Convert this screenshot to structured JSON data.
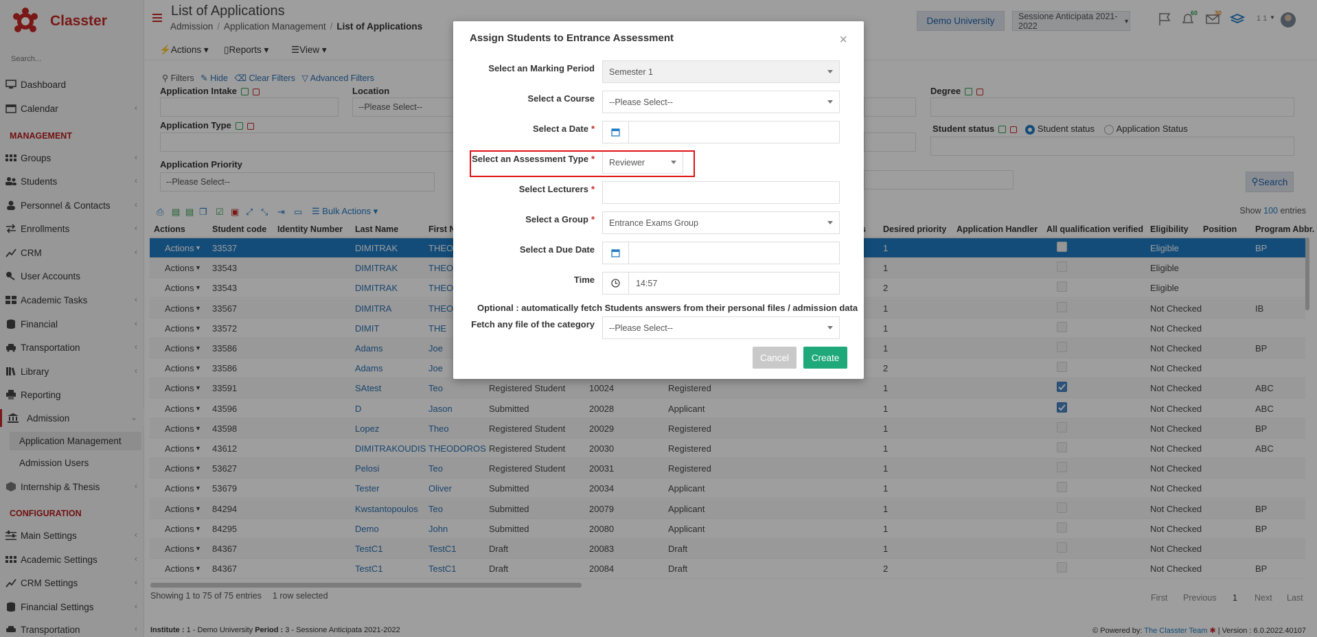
{
  "app": {
    "name": "Classter",
    "brand_color": "#c62828",
    "accent_color": "#1f7bc3"
  },
  "sidebar": {
    "search_placeholder": "Search...",
    "items": [
      {
        "label": "Dashboard",
        "icon": "monitor-icon"
      },
      {
        "label": "Calendar",
        "icon": "calendar-icon"
      },
      {
        "label": "Groups",
        "icon": "groups-icon"
      },
      {
        "label": "Students",
        "icon": "users-icon"
      },
      {
        "label": "Personnel & Contacts",
        "icon": "person-icon"
      },
      {
        "label": "Enrollments",
        "icon": "exchange-icon"
      },
      {
        "label": "CRM",
        "icon": "chart-icon"
      },
      {
        "label": "User Accounts",
        "icon": "key-icon"
      },
      {
        "label": "Academic Tasks",
        "icon": "grid-icon"
      },
      {
        "label": "Financial",
        "icon": "database-icon"
      },
      {
        "label": "Transportation",
        "icon": "car-icon"
      },
      {
        "label": "Library",
        "icon": "books-icon"
      },
      {
        "label": "Reporting",
        "icon": "print-icon"
      },
      {
        "label": "Admission",
        "icon": "bank-icon"
      },
      {
        "label": "Internship & Thesis",
        "icon": "cube-icon"
      },
      {
        "label": "Main Settings",
        "icon": "sliders-icon"
      },
      {
        "label": "Academic Settings",
        "icon": "groups-icon"
      },
      {
        "label": "CRM Settings",
        "icon": "chart-icon"
      },
      {
        "label": "Financial Settings",
        "icon": "database-icon"
      },
      {
        "label": "Transportation",
        "icon": "car-icon"
      }
    ],
    "heading_management": "MANAGEMENT",
    "heading_configuration": "CONFIGURATION",
    "sub_items": [
      "Application Management",
      "Admission Users"
    ]
  },
  "header": {
    "title": "List of Applications",
    "breadcrumb": [
      "Admission",
      "Application Management",
      "List of Applications"
    ],
    "institution": "Demo University",
    "period": "Sessione Anticipata 2021-2022",
    "badge_notifications": "60",
    "badge_messages": "30",
    "user_count": "1 1"
  },
  "toolbar": {
    "actions": "Actions",
    "reports": "Reports",
    "view": "View"
  },
  "filters": {
    "title": "Filters",
    "hide": "Hide",
    "clear": "Clear Filters",
    "advanced": "Advanced Filters",
    "application_intake": "Application Intake",
    "location": "Location",
    "location_value": "--Please Select--",
    "degree": "Degree",
    "application_type": "Application Type",
    "student_status": "Student status",
    "radio_student_status": "Student status",
    "radio_application_status": "Application Status",
    "application_priority": "Application Priority",
    "priority_value": "--Please Select--",
    "search": "Search"
  },
  "grid": {
    "bulk_actions": "Bulk Actions",
    "show_label": "Show",
    "show_value": "100",
    "entries_label": "entries",
    "columns": [
      "Actions",
      "Student code",
      "Identity Number",
      "Last Name",
      "First N",
      "s",
      "Desired priority",
      "Application Handler",
      "All qualification verified",
      "Eligibility",
      "Position",
      "Program Abbr."
    ],
    "rows": [
      {
        "action": "Actions",
        "code": "33537",
        "last": "DIMITRAK",
        "first": "THEO",
        "status": "",
        "num": "",
        "reg": "",
        "priority": "1",
        "verified": false,
        "eligibility": "Eligible",
        "program": "BP"
      },
      {
        "action": "Actions",
        "code": "33543",
        "last": "DIMITRAK",
        "first": "THEO",
        "status": "",
        "num": "",
        "reg": "",
        "priority": "1",
        "verified": false,
        "eligibility": "Eligible",
        "program": ""
      },
      {
        "action": "Actions",
        "code": "33543",
        "last": "DIMITRAK",
        "first": "THEO",
        "status": "",
        "num": "",
        "reg": "",
        "priority": "2",
        "verified": false,
        "eligibility": "Eligible",
        "program": ""
      },
      {
        "action": "Actions",
        "code": "33567",
        "last": "DIMITRA",
        "first": "THEO",
        "status": "",
        "num": "",
        "reg": "",
        "priority": "1",
        "verified": false,
        "eligibility": "Not Checked",
        "program": "IB"
      },
      {
        "action": "Actions",
        "code": "33572",
        "last": "DIMIT",
        "first": "THE",
        "status": "",
        "num": "",
        "reg": "",
        "priority": "1",
        "verified": false,
        "eligibility": "Not Checked",
        "program": ""
      },
      {
        "action": "Actions",
        "code": "33586",
        "last": "Adams",
        "first": "Joe",
        "status": "",
        "num": "",
        "reg": "",
        "priority": "1",
        "verified": false,
        "eligibility": "Not Checked",
        "program": "BP"
      },
      {
        "action": "Actions",
        "code": "33586",
        "last": "Adams",
        "first": "Joe",
        "status": "",
        "num": "",
        "reg": "",
        "priority": "2",
        "verified": false,
        "eligibility": "Not Checked",
        "program": ""
      },
      {
        "action": "Actions",
        "code": "33591",
        "last": "SAtest",
        "first": "Teo",
        "status": "Registered Student",
        "num": "10024",
        "reg": "Registered",
        "priority": "1",
        "verified": true,
        "eligibility": "Not Checked",
        "program": "ABC"
      },
      {
        "action": "Actions",
        "code": "43596",
        "last": "D",
        "first": "Jason",
        "status": "Submitted",
        "num": "20028",
        "reg": "Applicant",
        "priority": "1",
        "verified": true,
        "eligibility": "Not Checked",
        "program": "ABC"
      },
      {
        "action": "Actions",
        "code": "43598",
        "last": "Lopez",
        "first": "Theo",
        "status": "Registered Student",
        "num": "20029",
        "reg": "Registered",
        "priority": "1",
        "verified": false,
        "eligibility": "Not Checked",
        "program": "BP"
      },
      {
        "action": "Actions",
        "code": "43612",
        "last": "DIMITRAKOUDIS",
        "first": "THEODOROS",
        "status": "Registered Student",
        "num": "20030",
        "reg": "Registered",
        "priority": "1",
        "verified": false,
        "eligibility": "Not Checked",
        "program": "ABC"
      },
      {
        "action": "Actions",
        "code": "53627",
        "last": "Pelosi",
        "first": "Teo",
        "status": "Registered Student",
        "num": "20031",
        "reg": "Registered",
        "priority": "1",
        "verified": false,
        "eligibility": "Not Checked",
        "program": ""
      },
      {
        "action": "Actions",
        "code": "53679",
        "last": "Tester",
        "first": "Oliver",
        "status": "Submitted",
        "num": "20034",
        "reg": "Applicant",
        "priority": "1",
        "verified": false,
        "eligibility": "Not Checked",
        "program": ""
      },
      {
        "action": "Actions",
        "code": "84294",
        "last": "Kwstantopoulos",
        "first": "Teo",
        "status": "Submitted",
        "num": "20079",
        "reg": "Applicant",
        "priority": "1",
        "verified": false,
        "eligibility": "Not Checked",
        "program": "BP"
      },
      {
        "action": "Actions",
        "code": "84295",
        "last": "Demo",
        "first": "John",
        "status": "Submitted",
        "num": "20080",
        "reg": "Applicant",
        "priority": "1",
        "verified": false,
        "eligibility": "Not Checked",
        "program": "BP"
      },
      {
        "action": "Actions",
        "code": "84367",
        "last": "TestC1",
        "first": "TestC1",
        "status": "Draft",
        "num": "20083",
        "reg": "Draft",
        "priority": "1",
        "verified": false,
        "eligibility": "Not Checked",
        "program": ""
      },
      {
        "action": "Actions",
        "code": "84367",
        "last": "TestC1",
        "first": "TestC1",
        "status": "Draft",
        "num": "20084",
        "reg": "Draft",
        "priority": "2",
        "verified": false,
        "eligibility": "Not Checked",
        "program": "BP"
      }
    ],
    "showing": "Showing 1 to 75 of 75 entries",
    "selected": "1 row selected",
    "pager": [
      "First",
      "Previous",
      "1",
      "Next",
      "Last"
    ]
  },
  "modal": {
    "title": "Assign Students to Entrance Assessment",
    "close": "×",
    "marking_period_label": "Select an Marking Period",
    "marking_period_value": "Semester 1",
    "course_label": "Select a Course",
    "course_value": "--Please Select--",
    "date_label": "Select a Date",
    "date_value": "",
    "assessment_type_label": "Select an Assessment Type",
    "assessment_type_value": "Reviewer",
    "lecturers_label": "Select Lecturers",
    "group_label": "Select a Group",
    "group_value": "Entrance Exams Group",
    "due_date_label": "Select a Due Date",
    "time_label": "Time",
    "time_value": "14:57",
    "optional_text": "Optional : automatically fetch Students answers from their personal files / admission data",
    "fetch_label": "Fetch any file of the category",
    "fetch_value": "--Please Select--",
    "required_mark": "*",
    "cancel": "Cancel",
    "create": "Create"
  },
  "footer": {
    "institute_label": "Institute :",
    "institute_value": "1 - Demo University",
    "period_label": "Period :",
    "period_value": "3 - Sessione Anticipata 2021-2022",
    "powered_label": "Powered by:",
    "powered_by": "The Classter Team",
    "version": "| Version : 6.0.2022.40107"
  }
}
